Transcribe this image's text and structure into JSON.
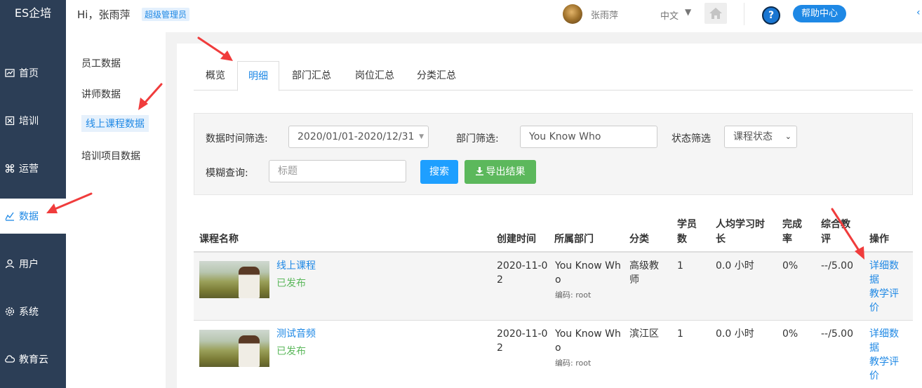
{
  "sidebar": {
    "logo": "ES企培",
    "items": [
      {
        "label": "首页",
        "icon": "chart-line-icon"
      },
      {
        "label": "培训",
        "icon": "book-icon"
      },
      {
        "label": "运营",
        "icon": "command-icon"
      },
      {
        "label": "数据",
        "icon": "bar-chart-icon",
        "active": true
      },
      {
        "label": "用户",
        "icon": "user-icon"
      },
      {
        "label": "系统",
        "icon": "gear-icon"
      },
      {
        "label": "教育云",
        "icon": "cloud-icon"
      }
    ]
  },
  "header": {
    "greeting": "Hi，张雨萍",
    "role": "超级管理员",
    "username": "张雨萍",
    "language": "中文",
    "help_label": "帮助中心",
    "help_icon_text": "?"
  },
  "subnav": {
    "items": [
      {
        "label": "员工数据"
      },
      {
        "label": "讲师数据"
      },
      {
        "label": "线上课程数据",
        "active": true
      },
      {
        "label": "培训项目数据"
      }
    ]
  },
  "tabs": [
    {
      "label": "概览"
    },
    {
      "label": "明细",
      "active": true
    },
    {
      "label": "部门汇总"
    },
    {
      "label": "岗位汇总"
    },
    {
      "label": "分类汇总"
    }
  ],
  "filters": {
    "date_label": "数据时间筛选:",
    "date_value": "2020/01/01-2020/12/31",
    "dept_label": "部门筛选:",
    "dept_value": "You Know Who",
    "status_label": "状态筛选",
    "status_value": "课程状态",
    "fuzzy_label": "模糊查询:",
    "fuzzy_placeholder": "标题",
    "search_button": "搜索",
    "export_button": "导出结果"
  },
  "table": {
    "headers": {
      "name": "课程名称",
      "created": "创建时间",
      "dept": "所属部门",
      "category": "分类",
      "students_1": "学员",
      "students_2": "数",
      "avg_1": "人均学习时",
      "avg_2": "长",
      "completion_1": "完成",
      "completion_2": "率",
      "rating_1": "综合教",
      "rating_2": "评",
      "ops": "操作"
    },
    "rows": [
      {
        "title": "线上课程",
        "status": "已发布",
        "created_1": "2020-11-0",
        "created_2": "2",
        "dept_1": "You Know Wh",
        "dept_2": "o",
        "dept_code": "编码: root",
        "category_1": "高级教",
        "category_2": "师",
        "students": "1",
        "avg_time": "0.0 小时",
        "completion": "0%",
        "rating": "--/5.00",
        "op_detail_1": "详细数",
        "op_detail_2": "据",
        "op_eval_1": "教学评",
        "op_eval_2": "价"
      },
      {
        "title": "测试音频",
        "status": "已发布",
        "created_1": "2020-11-0",
        "created_2": "2",
        "dept_1": "You Know Wh",
        "dept_2": "o",
        "dept_code": "编码: root",
        "category_1": "滨江区",
        "category_2": "",
        "students": "1",
        "avg_time": "0.0 小时",
        "completion": "0%",
        "rating": "--/5.00",
        "op_detail_1": "详细数",
        "op_detail_2": "据",
        "op_eval_1": "教学评",
        "op_eval_2": "价"
      }
    ]
  },
  "colors": {
    "nav_bg": "#2c3e56",
    "accent": "#1e88e5",
    "search_btn": "#1e9fff",
    "export_btn": "#5cb85c",
    "published": "#5cb85c",
    "annotation_arrow": "#f03c3c"
  }
}
